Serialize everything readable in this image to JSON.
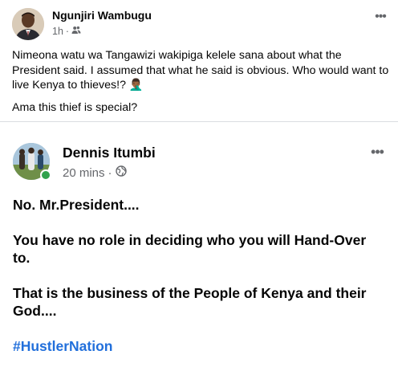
{
  "post": {
    "author": "Ngunjiri Wambugu",
    "time": "1h",
    "separator": "·",
    "paragraphs": [
      "Nimeona watu wa Tangawizi wakipiga kelele sana about what the President said. I assumed that what he said is obvious. Who would want to live Kenya to thieves!? 🤦🏾‍♂️",
      "Ama this thief is special?"
    ],
    "icons": {
      "privacy": "friends-icon",
      "more": "more-options-icon"
    }
  },
  "shared_post": {
    "author": "Dennis Itumbi",
    "time": "20 mins",
    "separator": "·",
    "paragraphs": [
      "No. Mr.President....",
      "You have no role in deciding who you will Hand-Over to.",
      "That is the business of the People of Kenya and their God...."
    ],
    "hashtag": "#HustlerNation",
    "online_status_color": "#31a24c",
    "icons": {
      "privacy": "globe-icon",
      "more": "more-options-icon"
    }
  },
  "colors": {
    "meta_gray": "#65676b",
    "link_blue": "#216fdb",
    "divider": "#dadde1"
  }
}
